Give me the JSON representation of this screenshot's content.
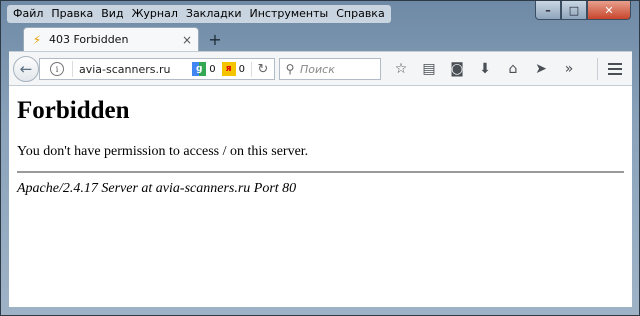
{
  "menu": {
    "items": [
      "Файл",
      "Правка",
      "Вид",
      "Журнал",
      "Закладки",
      "Инструменты",
      "Справка"
    ]
  },
  "window_controls": {
    "minimize": "–",
    "maximize": "□",
    "close": "✕"
  },
  "tab": {
    "title": "403 Forbidden",
    "close": "×",
    "new_tab": "+"
  },
  "navbar": {
    "url": "avia-scanners.ru",
    "google_badge": "g",
    "google_count": "0",
    "yandex_badge": "я",
    "yandex_count": "0",
    "search_placeholder": "Поиск"
  },
  "page": {
    "heading": "Forbidden",
    "message": "You don't have permission to access / on this server.",
    "server_signature": "Apache/2.4.17 Server at avia-scanners.ru Port 80"
  },
  "colors": {
    "close_button": "#c7452c",
    "chrome": "#f3f5f7"
  },
  "icons": [
    "back-arrow-icon",
    "info-icon",
    "reload-icon",
    "search-icon",
    "star-icon",
    "reading-list-icon",
    "pocket-icon",
    "download-icon",
    "home-icon",
    "send-icon",
    "overflow-chevron-icon",
    "hamburger-menu-icon"
  ]
}
